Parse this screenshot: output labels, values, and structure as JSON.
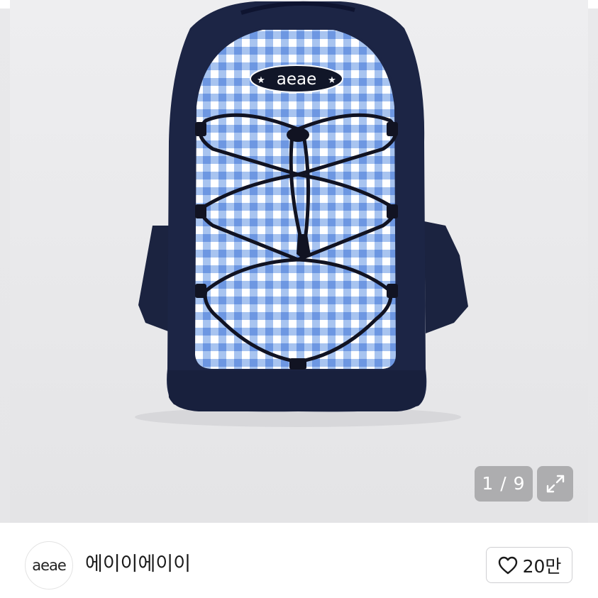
{
  "gallery": {
    "counter": "1 / 9",
    "brand_patch": "aeae"
  },
  "seller": {
    "avatar_logo": "aeae",
    "name": "에이이에이이"
  },
  "like": {
    "count": "20만"
  }
}
